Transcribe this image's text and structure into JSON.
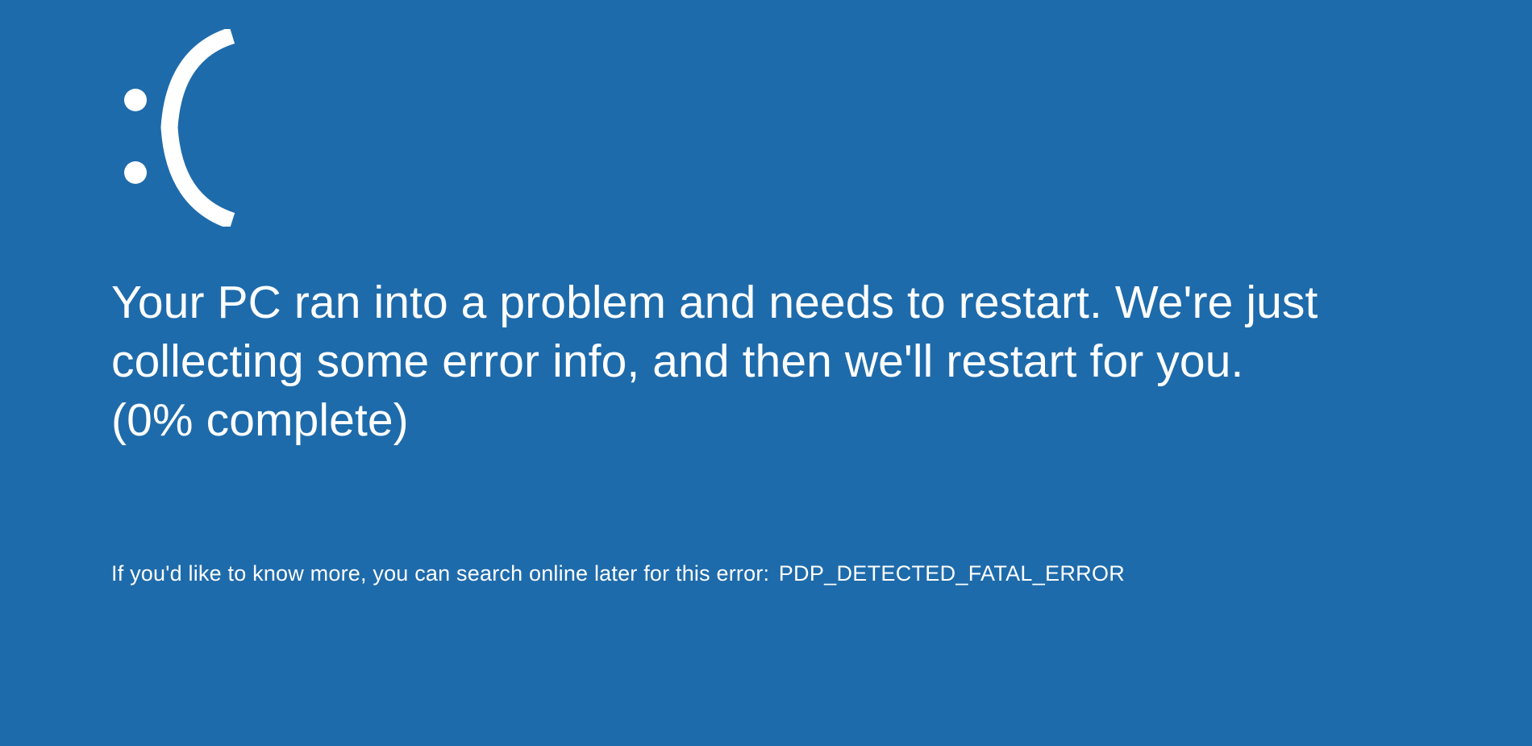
{
  "bsod": {
    "message": "Your PC ran into a problem and needs to restart. We're just collecting some error info, and then we'll restart for you. (0% complete)",
    "search_prefix": "If you'd like to know more, you can search online later for this error:",
    "error_code": "PDP_DETECTED_FATAL_ERROR",
    "background_color": "#1e6bab",
    "text_color": "#ffffff",
    "progress_percent": 0
  }
}
